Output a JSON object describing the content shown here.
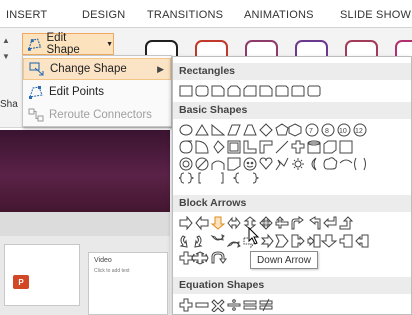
{
  "ribbon": {
    "tabs": [
      "INSERT",
      "DESIGN",
      "TRANSITIONS",
      "ANIMATIONS",
      "SLIDE SHOW"
    ],
    "edit_shape_label": "Edit Shape",
    "left_stub_label": "Sha"
  },
  "edit_shape_menu": {
    "items": [
      {
        "label": "Change Shape",
        "icon": "change-shape-icon",
        "highlighted": true,
        "has_submenu": true
      },
      {
        "label": "Edit Points",
        "icon": "edit-points-icon",
        "highlighted": false
      },
      {
        "label": "Reroute Connectors",
        "icon": "reroute-connectors-icon",
        "disabled": true
      }
    ]
  },
  "shapes_gallery": {
    "sections": [
      {
        "title": "Rectangles"
      },
      {
        "title": "Basic Shapes"
      },
      {
        "title": "Block Arrows"
      },
      {
        "title": "Equation Shapes"
      }
    ],
    "tooltip": "Down Arrow"
  },
  "slides": {
    "thumb_label": "Video",
    "thumb_subtext": "Click to add text",
    "app_icon_label": "P"
  },
  "colors": {
    "accent_orange": "#f0a860",
    "highlight": "#fbe4c5",
    "slide_maroon": "#4a1a3a",
    "powerpoint_red": "#d24726"
  }
}
